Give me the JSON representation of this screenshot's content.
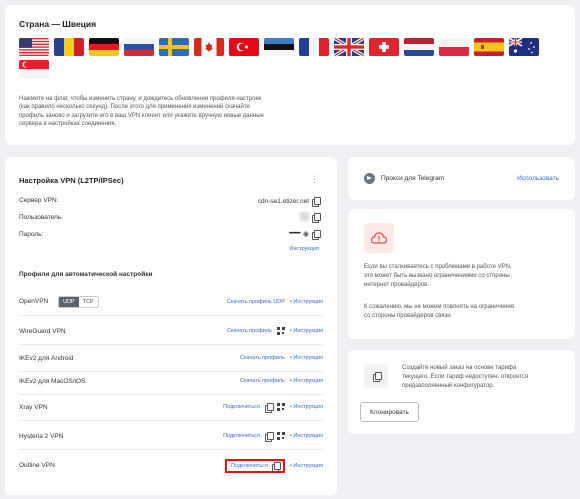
{
  "country": {
    "title": "Страна — Швеция",
    "flags": [
      "United States",
      "Romania",
      "Germany",
      "Russia",
      "Sweden",
      "Canada",
      "Turkey",
      "Estonia",
      "France",
      "United Kingdom",
      "Switzerland",
      "Netherlands",
      "Poland",
      "Spain",
      "Australia",
      "Singapore"
    ],
    "selected": "Sweden",
    "help_lines": [
      "Нажмите на флаг, чтобы изменить страну, и дождитесь обновления профиля настроек",
      "(как правило несколько секунд). После этого для применения изменений скачайте",
      "профиль заново и загрузите его в ваш VPN  клиент или укажите вручную новые данные",
      "сервера в настройках соединения."
    ]
  },
  "vpn": {
    "title": "Настройка VPN (L2TP/IPSec)",
    "menu_icon": "more-vertical-icon",
    "server_label": "Сервер VPN:",
    "server_value": "cdn-se1.etizer.net",
    "user_label": "Пользователь:",
    "password_label": "Пароль:",
    "password_value": "••••••••••",
    "instructions_link": "Инструкция",
    "profiles_title": "Профили для автоматической настройки",
    "protocols": [
      {
        "name": "OpenVPN",
        "toggle": [
          "UDP",
          "TCP"
        ],
        "toggle_selected": "UDP",
        "action": "Скачать профиль UDP",
        "instructions": "• Инструкция"
      },
      {
        "name": "WireGuard VPN",
        "action": "Скачать профиль",
        "instructions": "• Инструкция"
      },
      {
        "name": "IKEv2 для Android",
        "action": "Скачать профиль",
        "instructions": "• Инструкция"
      },
      {
        "name": "IKEv2 для MacOS/iOS",
        "action": "Скачать профиль",
        "instructions": "• Инструкция"
      },
      {
        "name": "Xray VPN",
        "action": "Подключиться",
        "instructions": "• Инструкция"
      },
      {
        "name": "Hysteria 2 VPN",
        "action": "Подключиться",
        "instructions": "• Инструкция"
      },
      {
        "name": "Outline VPN",
        "action": "Подключиться",
        "instructions": "• Инструкция"
      }
    ]
  },
  "telegram": {
    "label": "Прокси для Telegram",
    "link": "Использовать"
  },
  "warning": {
    "text1_lines": [
      "Если вы сталкиваетесь с проблемами в работе VPN,",
      "это может быть вызвано ограничениями со стороны",
      "интернет провайдеров."
    ],
    "text2_lines": [
      "К сожалению, мы не можем повлиять на ограничения",
      "со стороны провайдеров связи."
    ]
  },
  "clone": {
    "text_lines": [
      "Создайте новый заказ на основе тарифа",
      "текущего. Если тариф недоступен, откроется",
      "предзаполненный конфигуратор."
    ],
    "button": "Клонировать"
  },
  "colors": {
    "accent": "#3b6bd6",
    "highlight": "#e01515",
    "background": "#eef0f4"
  }
}
